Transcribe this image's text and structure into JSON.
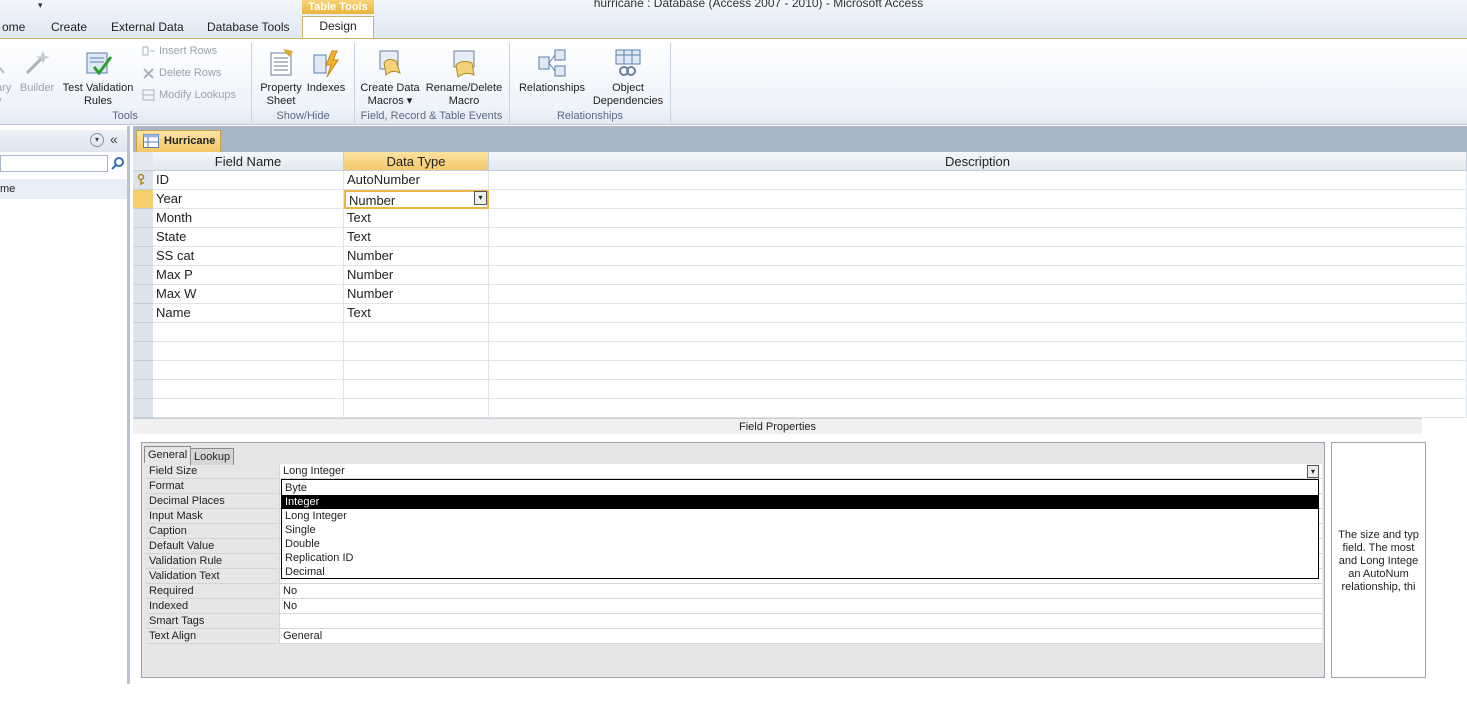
{
  "window": {
    "title": "hurricane : Database (Access 2007 - 2010)  -  Microsoft Access",
    "contextual_tab": "Table Tools"
  },
  "ribbon_tabs": [
    "ome",
    "Create",
    "External Data",
    "Database Tools",
    "Design"
  ],
  "ribbon": {
    "tools": {
      "label": "Tools",
      "primary_key_partial": [
        "ary",
        "y"
      ],
      "builder": "Builder",
      "test_validation": [
        "Test Validation",
        "Rules"
      ],
      "insert_rows": "Insert Rows",
      "delete_rows": "Delete Rows",
      "modify_lookups": "Modify Lookups"
    },
    "showhide": {
      "label": "Show/Hide",
      "property_sheet": [
        "Property",
        "Sheet"
      ],
      "indexes": "Indexes"
    },
    "events": {
      "label": "Field, Record & Table Events",
      "create_data_macros": [
        "Create Data",
        "Macros ▾"
      ],
      "rename_delete_macro": [
        "Rename/Delete",
        "Macro"
      ]
    },
    "relationships": {
      "label": "Relationships",
      "relationships": "Relationships",
      "object_dependencies": [
        "Object",
        "Dependencies"
      ]
    }
  },
  "nav": {
    "item": "me"
  },
  "document": {
    "tab_label": "Hurricane",
    "headers": {
      "field_name": "Field Name",
      "data_type": "Data Type",
      "description": "Description"
    },
    "rows": [
      {
        "name": "ID",
        "type": "AutoNumber",
        "key": true
      },
      {
        "name": "Year",
        "type": "Number",
        "active": true
      },
      {
        "name": "Month",
        "type": "Text"
      },
      {
        "name": "State",
        "type": "Text"
      },
      {
        "name": "SS cat",
        "type": "Number"
      },
      {
        "name": "Max P",
        "type": "Number"
      },
      {
        "name": "Max W",
        "type": "Number"
      },
      {
        "name": "Name",
        "type": "Text"
      }
    ]
  },
  "field_properties": {
    "title": "Field Properties",
    "tabs": [
      "General",
      "Lookup"
    ],
    "labels": [
      "Field Size",
      "Format",
      "Decimal Places",
      "Input Mask",
      "Caption",
      "Default Value",
      "Validation Rule",
      "Validation Text",
      "Required",
      "Indexed",
      "Smart Tags",
      "Text Align"
    ],
    "values": {
      "field_size": "Long Integer",
      "required": "No",
      "indexed": "No",
      "smart_tags": "",
      "text_align": "General"
    },
    "dropdown_options": [
      "Byte",
      "Integer",
      "Long Integer",
      "Single",
      "Double",
      "Replication ID",
      "Decimal"
    ],
    "selected_option": "Integer",
    "help_lines": [
      "The size and typ",
      "field. The most",
      "and Long Intege",
      "an AutoNum",
      "relationship, thi"
    ]
  }
}
